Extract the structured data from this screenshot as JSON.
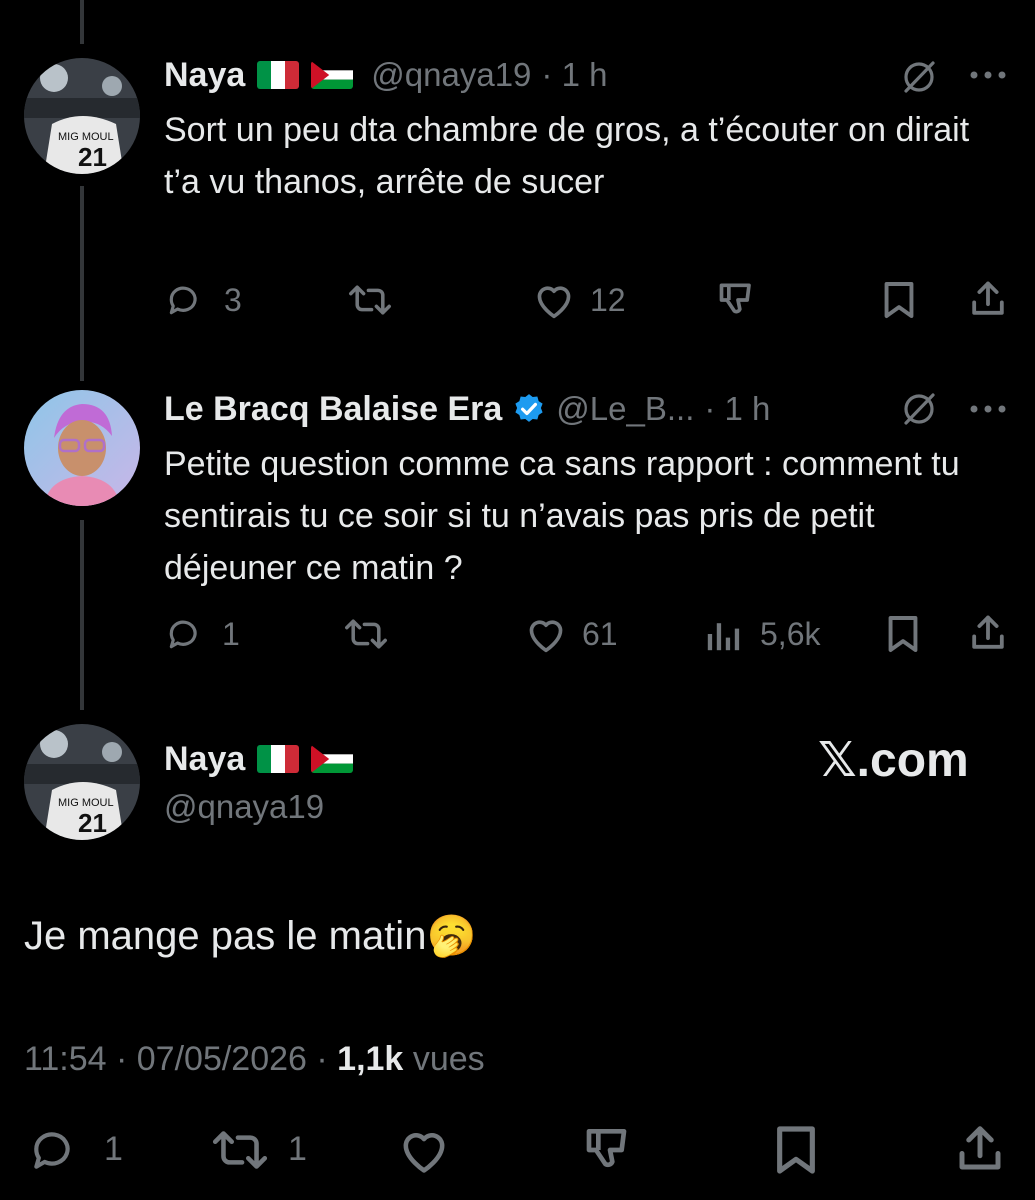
{
  "tweets": [
    {
      "name": "Naya",
      "handle": "@qnaya19",
      "time": "· 1 h",
      "text": "Sort un peu dta chambre de gros, a t’écouter on dirait t’a vu thanos, arrête de sucer",
      "replies": "3",
      "likes": "12"
    },
    {
      "name": "Le Bracq Balaise Era",
      "handle": "@Le_B...",
      "time": "· 1 h",
      "text": "Petite question comme ca sans rapport : comment tu sentirais tu ce soir si tu n’avais pas pris de petit déjeuner ce matin ?",
      "replies": "1",
      "likes": "61",
      "views": "5,6k"
    }
  ],
  "main": {
    "name": "Naya",
    "handle": "@qnaya19",
    "text": "Je mange pas le matin",
    "emoji": "🥱",
    "timestamp": "11:54 · 07/05/2026 ·",
    "views_count": "1,1k",
    "views_label": "vues",
    "replies": "1",
    "retweets": "1"
  },
  "watermark": "𝕏.com",
  "colors": {
    "background": "#000000",
    "text": "#e7e9ea",
    "muted": "#71767b",
    "verified": "#1d9bf0"
  }
}
